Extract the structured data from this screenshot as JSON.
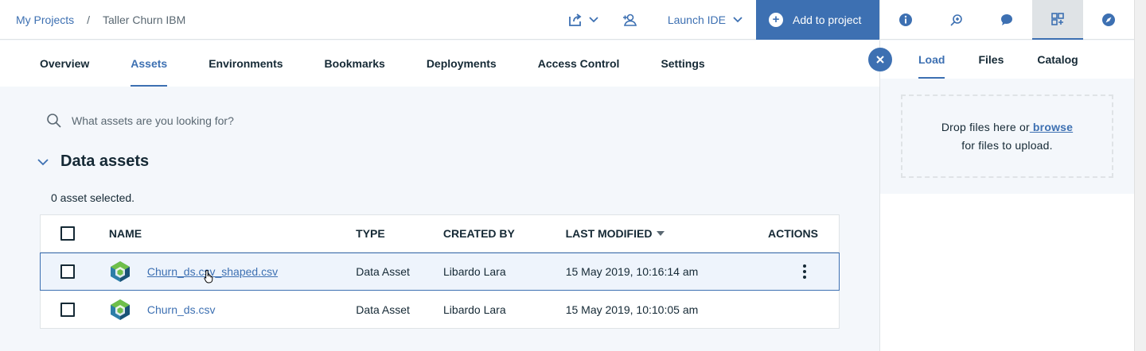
{
  "breadcrumb": {
    "root": "My Projects",
    "separator": "/",
    "current": "Taller Churn IBM"
  },
  "header": {
    "launch_label": "Launch IDE",
    "add_label": "Add to project"
  },
  "tabs": [
    "Overview",
    "Assets",
    "Environments",
    "Bookmarks",
    "Deployments",
    "Access Control",
    "Settings"
  ],
  "active_tab": "Assets",
  "search": {
    "placeholder": "What assets are you looking for?"
  },
  "section": {
    "title": "Data assets",
    "selected_text": "0 asset selected."
  },
  "table": {
    "columns": [
      "NAME",
      "TYPE",
      "CREATED BY",
      "LAST MODIFIED",
      "ACTIONS"
    ],
    "rows": [
      {
        "name": "Churn_ds.csv_shaped.csv",
        "type": "Data Asset",
        "created_by": "Libardo Lara",
        "modified": "15 May 2019, 10:16:14 am"
      },
      {
        "name": "Churn_ds.csv",
        "type": "Data Asset",
        "created_by": "Libardo Lara",
        "modified": "15 May 2019, 10:10:05 am"
      }
    ]
  },
  "side_icons": [
    "info-icon",
    "find-replace-icon",
    "comments-icon",
    "data-icon",
    "compass-icon"
  ],
  "panel": {
    "tabs": [
      "Load",
      "Files",
      "Catalog"
    ],
    "drop_text": "Drop files here or",
    "browse": " browse",
    "drop_text2": "for files to upload."
  },
  "colors": {
    "accent": "#3d70b2",
    "text": "#152935",
    "background": "#f4f7fb"
  }
}
